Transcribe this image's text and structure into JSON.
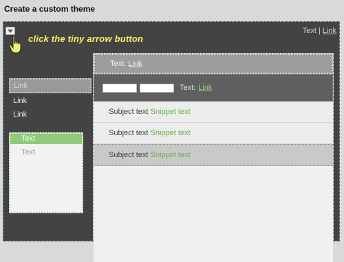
{
  "window": {
    "title": "Create a custom theme"
  },
  "canvas": {
    "hint_text": "click the tiny arrow button",
    "top_links": {
      "text": "Text",
      "separator": "|",
      "link": "Link"
    }
  },
  "sidenav": {
    "items": [
      {
        "label": "Link",
        "active": true
      },
      {
        "label": "Link",
        "active": false
      },
      {
        "label": "Link",
        "active": false
      }
    ]
  },
  "widget": {
    "header": "Text",
    "body": "Text"
  },
  "main": {
    "bar1": {
      "text": "Text:",
      "link": "Link"
    },
    "bar2": {
      "text": "Text:",
      "link": "Link"
    },
    "rows": [
      {
        "subject": "Subject text",
        "snippet": "Snippet text",
        "selected": false
      },
      {
        "subject": "Subject text",
        "snippet": "Snippet text",
        "selected": false
      },
      {
        "subject": "Subject text",
        "snippet": "Snippet text",
        "selected": true
      }
    ]
  },
  "colors": {
    "canvas_bg": "#434343",
    "accent_green": "#8fca7b",
    "snippet_green": "#6ab04c",
    "hint_yellow": "#f7f16a"
  },
  "icons": {
    "arrow": "chevron-down-icon",
    "pointer": "hand-pointer-icon"
  }
}
